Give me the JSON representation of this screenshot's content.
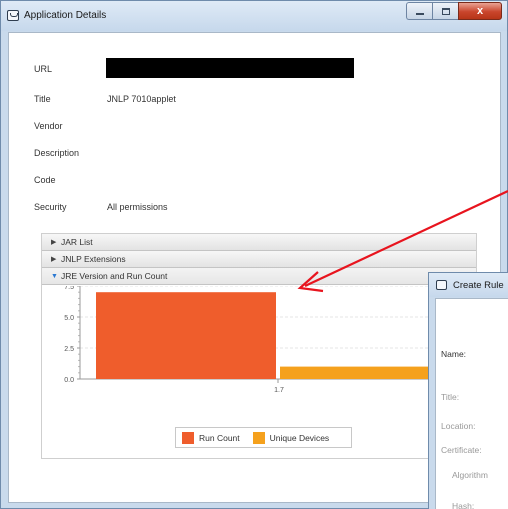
{
  "window": {
    "title": "Application Details",
    "controls": {
      "close": "x"
    }
  },
  "details": {
    "fields": [
      {
        "label": "URL",
        "value": ""
      },
      {
        "label": "Title",
        "value": "JNLP 7010applet"
      },
      {
        "label": "Vendor",
        "value": ""
      },
      {
        "label": "Description",
        "value": ""
      },
      {
        "label": "Code",
        "value": ""
      },
      {
        "label": "Security",
        "value": "All permissions"
      }
    ]
  },
  "accordion": {
    "panes": [
      {
        "label": "JAR List",
        "expanded": false
      },
      {
        "label": "JNLP Extensions",
        "expanded": false
      },
      {
        "label": "JRE Version and Run Count",
        "expanded": true
      }
    ]
  },
  "chart_data": {
    "type": "bar",
    "categories": [
      "1.7"
    ],
    "series": [
      {
        "name": "Run Count",
        "values": [
          7.0
        ],
        "color": "#ef5d2c"
      },
      {
        "name": "Unique Devices",
        "values": [
          1.0
        ],
        "color": "#f5a11d"
      }
    ],
    "yticks": [
      "0.0",
      "2.5",
      "5.0",
      "7.5"
    ],
    "ylim": [
      0,
      7.5
    ],
    "grid": true,
    "legend_position": "bottom-center"
  },
  "create_rule": {
    "title": "Create Rule",
    "labels": [
      "Name:",
      "Title:",
      "Location:",
      "Certificate:",
      "Algorithm",
      "Hash:"
    ]
  },
  "colors": {
    "annotation_arrow": "#e8141e",
    "selected_triangle": "#2a78d2"
  }
}
